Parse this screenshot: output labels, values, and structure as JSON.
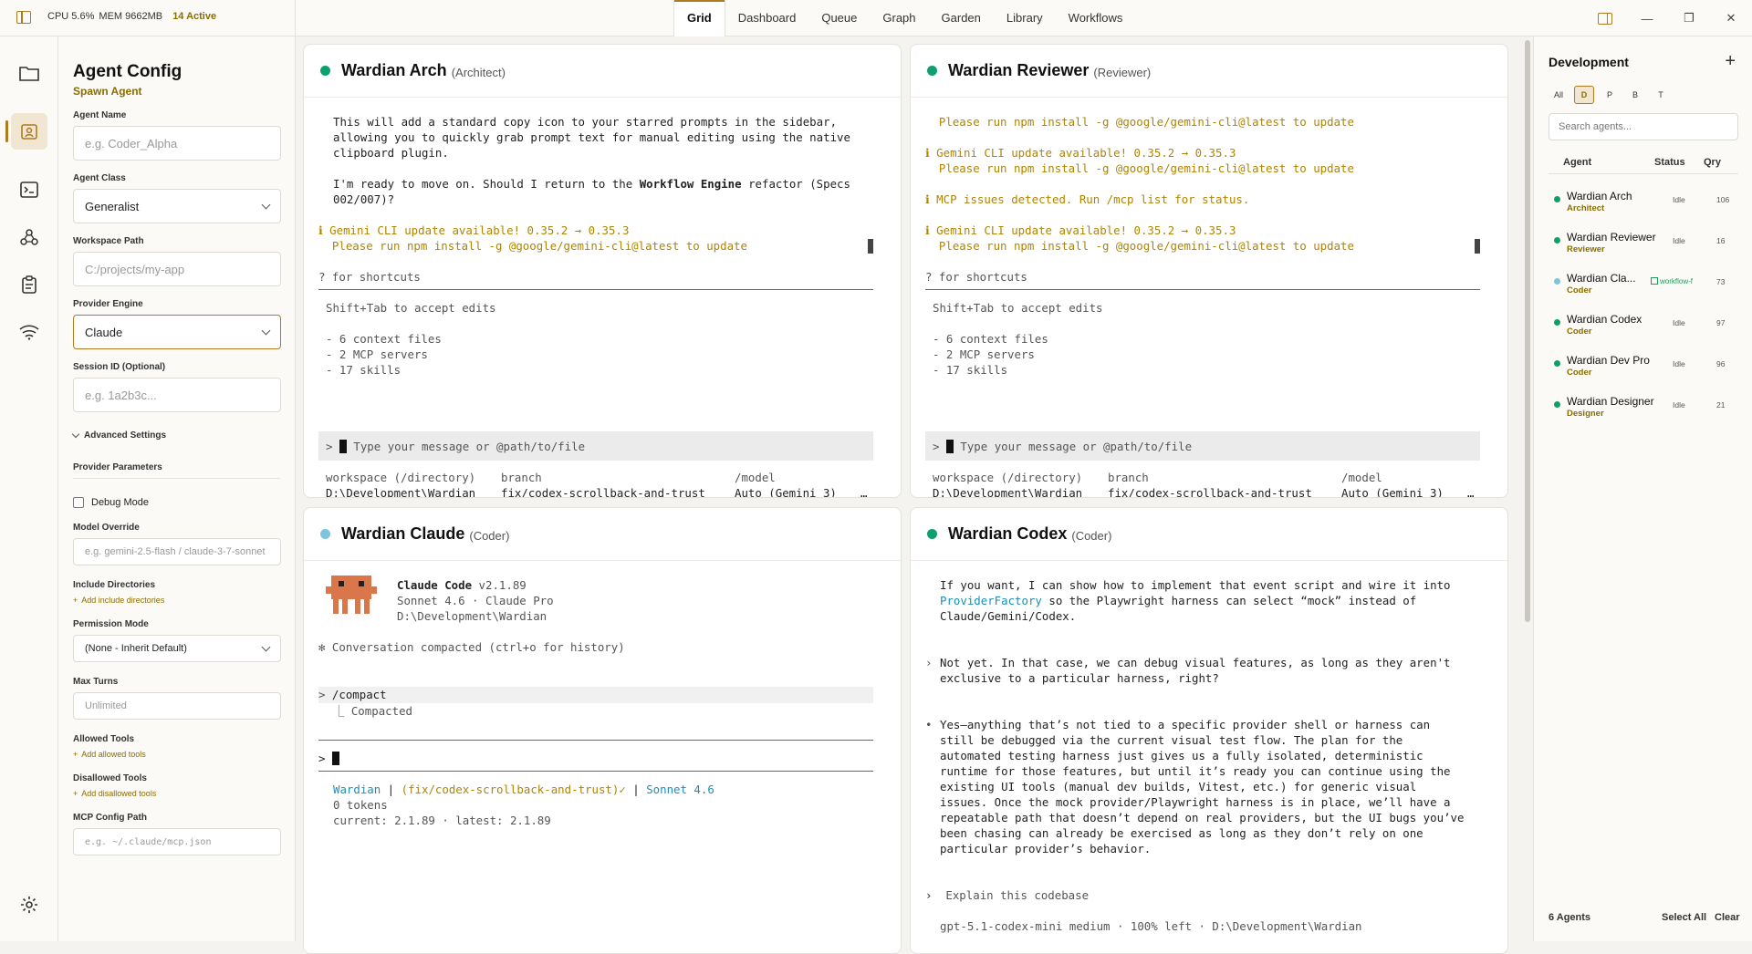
{
  "topbar": {
    "cpu": "CPU 5.6%",
    "mem": "MEM 9662MB",
    "active": "14 Active",
    "tabs": [
      "Grid",
      "Dashboard",
      "Queue",
      "Graph",
      "Garden",
      "Library",
      "Workflows"
    ],
    "active_tab": "Grid",
    "window_controls": [
      "panel-toggle-icon",
      "minimize-icon",
      "restore-icon",
      "close-icon"
    ]
  },
  "rail": {
    "icons": [
      "folder-icon",
      "agent-config-icon",
      "terminal-icon",
      "graph-icon",
      "clipboard-icon",
      "wifi-icon",
      "settings-icon"
    ],
    "selected": "agent-config-icon"
  },
  "config": {
    "title": "Agent Config",
    "subtitle": "Spawn Agent",
    "agent_name_label": "Agent Name",
    "agent_name_placeholder": "e.g. Coder_Alpha",
    "agent_class_label": "Agent Class",
    "agent_class_value": "Generalist",
    "workspace_label": "Workspace Path",
    "workspace_placeholder": "C:/projects/my-app",
    "provider_label": "Provider Engine",
    "provider_value": "Claude",
    "session_label": "Session ID (Optional)",
    "session_placeholder": "e.g. 1a2b3c...",
    "advanced_label": "Advanced Settings",
    "provider_params_label": "Provider Parameters",
    "debug_label": "Debug Mode",
    "model_override_label": "Model Override",
    "model_override_placeholder": "e.g. gemini-2.5-flash / claude-3-7-sonnet",
    "include_dirs_label": "Include Directories",
    "include_dirs_add": "Add include directories",
    "permission_label": "Permission Mode",
    "permission_value": "(None - Inherit Default)",
    "max_turns_label": "Max Turns",
    "max_turns_placeholder": "Unlimited",
    "allowed_label": "Allowed Tools",
    "allowed_add": "Add allowed tools",
    "disallowed_label": "Disallowed Tools",
    "disallowed_add": "Add disallowed tools",
    "mcp_label": "MCP Config Path",
    "mcp_placeholder": "e.g. ~/.claude/mcp.json"
  },
  "terminals": {
    "arch": {
      "name": "Wardian Arch",
      "role": "(Architect)",
      "lines": [
        "This will add a standard copy icon to your starred prompts in the sidebar,",
        "allowing you to quickly grab prompt text for manual editing using the native",
        "clipboard plugin."
      ],
      "ready_pre": "I'm ready to move on. Should I return to the ",
      "ready_bold": "Workflow Engine",
      "ready_post": " refactor (Specs",
      "ready_2": "002/007)?",
      "warn_1": "ℹ Gemini CLI update available! 0.35.2 → 0.35.3",
      "warn_2": "  Please run npm install -g @google/gemini-cli@latest to update",
      "shortcuts": "? for shortcuts",
      "accept": "Shift+Tab to accept edits",
      "ctx": [
        "- 6 context files",
        "- 2 MCP servers",
        "- 17 skills"
      ],
      "prompt_placeholder": "Type your message or @path/to/file",
      "footer_h": [
        "workspace (/directory)",
        "branch",
        "/model"
      ],
      "footer_v": [
        "D:\\Development\\Wardian",
        "fix/codex-scrollback-and-trust",
        "Auto (Gemini 3)",
        "…"
      ]
    },
    "reviewer": {
      "name": "Wardian Reviewer",
      "role": "(Reviewer)",
      "l1": "  Please run npm install -g @google/gemini-cli@latest to update",
      "l2": "ℹ Gemini CLI update available! 0.35.2 → 0.35.3",
      "l3": "  Please run npm install -g @google/gemini-cli@latest to update",
      "l4": "ℹ MCP issues detected. Run /mcp list for status.",
      "l5": "ℹ Gemini CLI update available! 0.35.2 → 0.35.3",
      "l6": "  Please run npm install -g @google/gemini-cli@latest to update",
      "shortcuts": "? for shortcuts",
      "accept": "Shift+Tab to accept edits",
      "ctx": [
        "- 6 context files",
        "- 2 MCP servers",
        "- 17 skills"
      ],
      "prompt_placeholder": "Type your message or @path/to/file",
      "footer_h": [
        "workspace (/directory)",
        "branch",
        "/model"
      ],
      "footer_v": [
        "D:\\Development\\Wardian",
        "fix/codex-scrollback-and-trust",
        "Auto (Gemini 3)",
        "…"
      ]
    },
    "claude": {
      "name": "Wardian Claude",
      "role": "(Coder)",
      "product": "Claude Code",
      "version": "v2.1.89",
      "model_line": "Sonnet 4.6 · Claude Pro",
      "path": "D:\\Development\\Wardian",
      "compacted_note": "✻ Conversation compacted (ctrl+o for history)",
      "cmd": "/compact",
      "cmd_result": "⎿ Compacted",
      "status_app": "Wardian",
      "status_branch": "(fix/codex-scrollback-and-trust)✓",
      "status_model": "Sonnet 4.6",
      "tokens": "0 tokens",
      "versions": "current: 2.1.89 · latest: 2.1.89"
    },
    "codex": {
      "name": "Wardian Codex",
      "role": "(Coder)",
      "p1a": "If you want, I can show how to implement that event script and wire it into",
      "p1b_link": "ProviderFactory",
      "p1b_rest": " so the Playwright harness can select “mock” instead of",
      "p1c": "Claude/Gemini/Codex.",
      "q1": "Not yet. In that case, we can debug visual features, as long as they aren't",
      "q2": "exclusive to a particular harness, right?",
      "a": [
        "Yes—anything that’s not tied to a specific provider shell or harness can",
        "still be debugged via the current visual test flow. The plan for the",
        "automated testing harness just gives us a fully isolated, deterministic",
        "runtime for those features, but until it’s ready you can continue using the",
        "existing UI tools (manual dev builds, Vitest, etc.) for generic visual",
        "issues. Once the mock provider/Playwright harness is in place, we’ll have a",
        "repeatable path that doesn’t depend on real providers, but the UI bugs you’ve",
        "been chasing can already be exercised as long as they don’t rely on one",
        "particular provider’s behavior."
      ],
      "prompt": "Explain this codebase",
      "status": "gpt-5.1-codex-mini medium · 100% left · D:\\Development\\Wardian"
    }
  },
  "agents_panel": {
    "title": "Development",
    "filters": [
      "All",
      "D",
      "P",
      "B",
      "T"
    ],
    "selected_filter": "D",
    "search_placeholder": "Search agents...",
    "headers": [
      "Agent",
      "Status",
      "Qry"
    ],
    "agents": [
      {
        "name": "Wardian Arch",
        "role": "Architect",
        "status": "Idle",
        "qry": "106",
        "badge": ""
      },
      {
        "name": "Wardian Reviewer",
        "role": "Reviewer",
        "status": "Idle",
        "qry": "16",
        "badge": ""
      },
      {
        "name": "Wardian Cla...",
        "role": "Coder",
        "status": "",
        "qry": "73",
        "badge": "workflow-f"
      },
      {
        "name": "Wardian Codex",
        "role": "Coder",
        "status": "Idle",
        "qry": "97",
        "badge": ""
      },
      {
        "name": "Wardian Dev Pro",
        "role": "Coder",
        "status": "Idle",
        "qry": "96",
        "badge": ""
      },
      {
        "name": "Wardian Designer",
        "role": "Designer",
        "status": "Idle",
        "qry": "21",
        "badge": ""
      }
    ],
    "count": "6 Agents",
    "select_all": "Select All",
    "clear": "Clear"
  },
  "colors": {
    "accent": "#b07a1f",
    "idle_dot": "#0e9f6e",
    "busy_dot": "#7ec4df",
    "warn": "#b08400"
  }
}
